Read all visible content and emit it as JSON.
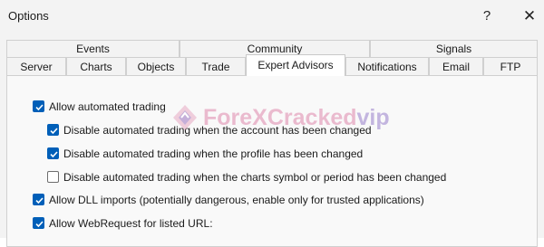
{
  "window": {
    "title": "Options",
    "help_label": "?",
    "close_label": "✕"
  },
  "tabs": {
    "row1": [
      {
        "label": "Events"
      },
      {
        "label": "Community"
      },
      {
        "label": "Signals"
      }
    ],
    "row2": [
      {
        "label": "Server"
      },
      {
        "label": "Charts"
      },
      {
        "label": "Objects"
      },
      {
        "label": "Trade"
      },
      {
        "label": "Expert Advisors",
        "active": true
      },
      {
        "label": "Notifications"
      },
      {
        "label": "Email"
      },
      {
        "label": "FTP"
      }
    ]
  },
  "options": [
    {
      "label": "Allow automated trading",
      "checked": true
    },
    {
      "label": "Disable automated trading when the account has been changed",
      "checked": true
    },
    {
      "label": "Disable automated trading when the profile has been changed",
      "checked": true
    },
    {
      "label": "Disable automated trading when the charts symbol or period has been changed",
      "checked": false
    },
    {
      "label": "Allow DLL imports (potentially dangerous, enable only for trusted applications)",
      "checked": true
    },
    {
      "label": "Allow WebRequest for listed URL:",
      "checked": true
    }
  ],
  "watermark": {
    "part1": "ForeXCracked",
    "part2": "vip"
  },
  "colors": {
    "checkbox_accent": "#005fb8",
    "watermark_pink": "#e7a9c3",
    "watermark_purple": "#b4a3d8"
  }
}
